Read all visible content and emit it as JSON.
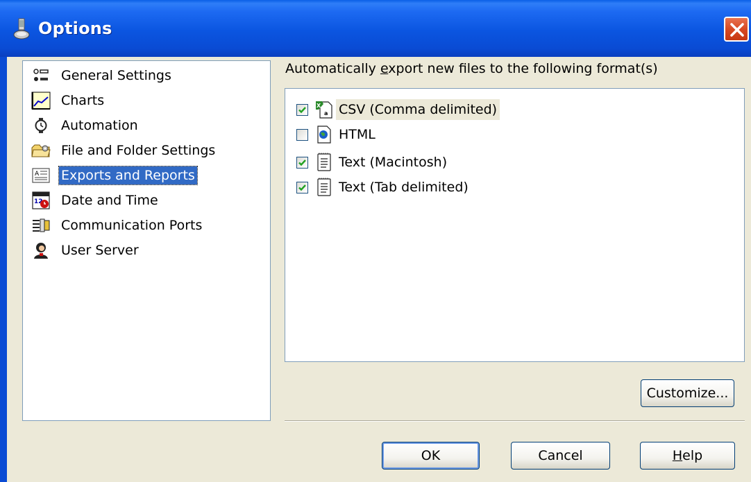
{
  "window": {
    "title": "Options",
    "title_icon": "options-app-icon",
    "close_icon": "close-icon"
  },
  "tree": {
    "items": [
      {
        "label": "General Settings",
        "icon": "general-settings-icon",
        "selected": false
      },
      {
        "label": "Charts",
        "icon": "charts-icon",
        "selected": false
      },
      {
        "label": "Automation",
        "icon": "automation-icon",
        "selected": false
      },
      {
        "label": "File and Folder Settings",
        "icon": "folder-settings-icon",
        "selected": false
      },
      {
        "label": "Exports and Reports",
        "icon": "exports-reports-icon",
        "selected": true
      },
      {
        "label": "Date and Time",
        "icon": "date-time-icon",
        "selected": false
      },
      {
        "label": "Communication Ports",
        "icon": "communication-ports-icon",
        "selected": false
      },
      {
        "label": "User Server",
        "icon": "user-server-icon",
        "selected": false
      }
    ]
  },
  "exports": {
    "label_prefix": "Automatically ",
    "label_mnemonic": "e",
    "label_suffix": "xport new files to the following format(s)",
    "formats": [
      {
        "label": "CSV (Comma delimited)",
        "checked": true,
        "icon": "excel-csv-icon"
      },
      {
        "label": "HTML",
        "checked": false,
        "icon": "html-document-icon"
      },
      {
        "label": "Text (Macintosh)",
        "checked": true,
        "icon": "text-document-icon"
      },
      {
        "label": "Text (Tab delimited)",
        "checked": true,
        "icon": "text-document-icon"
      }
    ]
  },
  "buttons": {
    "customize": "Customize...",
    "ok": "OK",
    "cancel": "Cancel",
    "help_mnemonic": "H",
    "help_rest": "elp"
  },
  "colors": {
    "titlebar": "#0a4bd4",
    "selection": "#316ac5",
    "dialog_bg": "#ece9d8",
    "check": "#21a121"
  }
}
